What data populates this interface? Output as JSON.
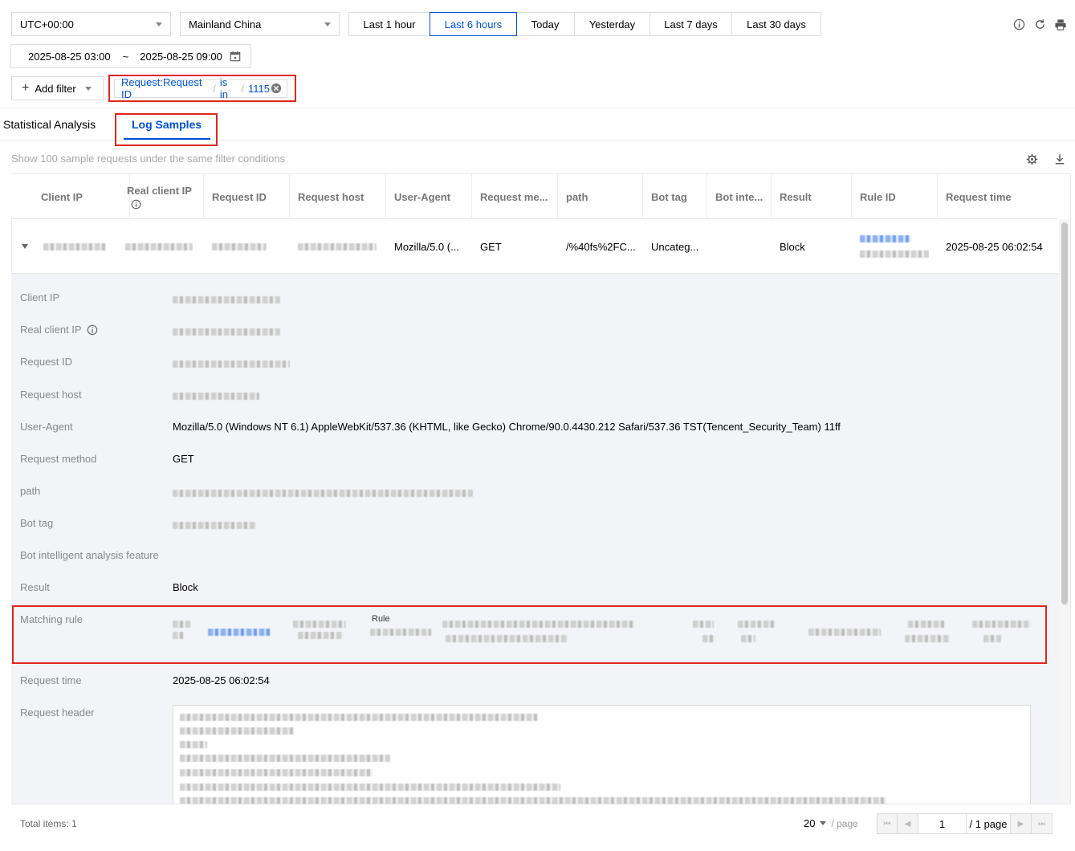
{
  "toolbar": {
    "timezone": "UTC+00:00",
    "region": "Mainland China",
    "ranges": [
      "Last 1 hour",
      "Last 6 hours",
      "Today",
      "Yesterday",
      "Last 7 days",
      "Last 30 days"
    ],
    "active_range": "Last 6 hours",
    "start_time": "2025-08-25 03:00",
    "range_sep": "~",
    "end_time": "2025-08-25 09:00"
  },
  "filter": {
    "add_label": "Add filter",
    "field": "Request:Request ID",
    "sep": "/",
    "operator": "is in",
    "value": "1115"
  },
  "tabs": {
    "stat": "Statistical Analysis",
    "logs": "Log Samples"
  },
  "hint": "Show 100 sample requests under the same filter conditions",
  "table": {
    "headers": [
      "Client IP",
      "Real client IP",
      "Request ID",
      "Request host",
      "User-Agent",
      "Request me...",
      "path",
      "Bot tag",
      "Bot inte...",
      "Result",
      "Rule ID",
      "Request time"
    ],
    "row": {
      "user_agent": "Mozilla/5.0 (...",
      "method": "GET",
      "path": "/%40fs%2FC...",
      "bot_tag": "Uncateg...",
      "result": "Block",
      "time": "2025-08-25 06:02:54"
    }
  },
  "detail": {
    "labels": {
      "client_ip": "Client IP",
      "real_client_ip": "Real client IP",
      "request_id": "Request ID",
      "request_host": "Request host",
      "user_agent": "User-Agent",
      "request_method": "Request method",
      "path": "path",
      "bot_tag": "Bot tag",
      "bot_feature": "Bot intelligent analysis feature",
      "result": "Result",
      "matching_rule": "Matching rule",
      "request_time": "Request time",
      "request_header": "Request header"
    },
    "values": {
      "user_agent": "Mozilla/5.0 (Windows NT 6.1) AppleWebKit/537.36 (KHTML, like Gecko) Chrome/90.0.4430.212 Safari/537.36 TST(Tencent_Security_Team) 11ff",
      "request_method": "GET",
      "result": "Block",
      "rule_fragment": "Rule",
      "request_time": "2025-08-25 06:02:54"
    }
  },
  "footer": {
    "total": "Total items:  1",
    "page_size": "20",
    "per_page": "/ page",
    "page": "1",
    "page_total": "/ 1 page"
  },
  "colors": {
    "accent": "#0052d9",
    "highlight": "#e1251b"
  }
}
